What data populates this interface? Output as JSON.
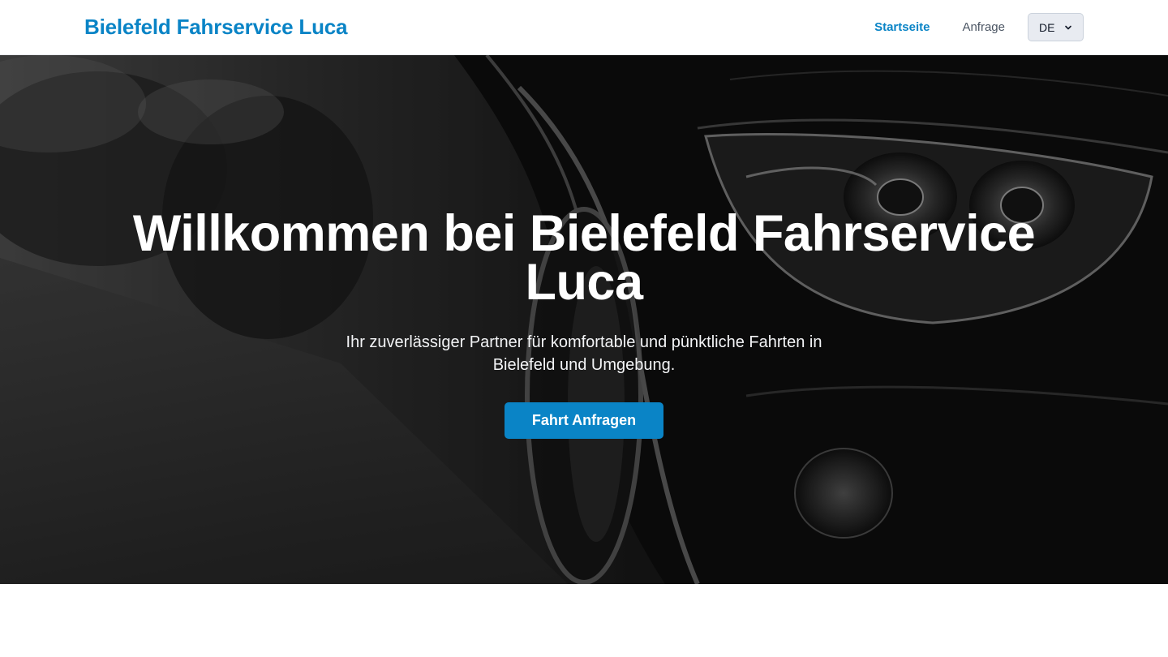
{
  "navbar": {
    "brand": "Bielefeld Fahrservice Luca",
    "links": [
      {
        "label": "Startseite",
        "active": true
      },
      {
        "label": "Anfrage",
        "active": false
      }
    ],
    "language": {
      "selected": "DE"
    }
  },
  "hero": {
    "title": "Willkommen bei Bielefeld Fahrservice Luca",
    "subtitle": "Ihr zuverlässiger Partner für komfortable und pünktliche Fahrten in Bielefeld und Umgebung.",
    "cta_label": "Fahrt Anfragen",
    "background": "grayscale-car-headlight-photo"
  },
  "colors": {
    "brand": "#0a84c6",
    "nav_inactive": "#4b5563",
    "select_bg": "#e8ebf1"
  }
}
